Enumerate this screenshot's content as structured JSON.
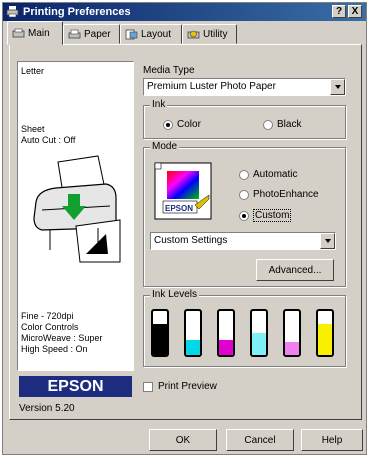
{
  "window": {
    "title": "Printing Preferences",
    "help_btn": "?",
    "close_btn": "X"
  },
  "tabs": [
    {
      "label": "Main",
      "active": true
    },
    {
      "label": "Paper",
      "active": false
    },
    {
      "label": "Layout",
      "active": false
    },
    {
      "label": "Utility",
      "active": false
    }
  ],
  "preview": {
    "paper_size": "Letter",
    "source": "Sheet",
    "auto_cut": "Auto Cut : Off",
    "resolution": "Fine - 720dpi",
    "color_controls": "Color Controls",
    "microweave": "MicroWeave : Super",
    "high_speed": "High Speed : On"
  },
  "brand": {
    "logo": "EPSON",
    "version": "Version 5.20"
  },
  "media_type": {
    "label": "Media Type",
    "value": "Premium Luster Photo Paper"
  },
  "ink": {
    "label": "Ink",
    "options": [
      "Color",
      "Black"
    ],
    "selected": "Color"
  },
  "mode": {
    "label": "Mode",
    "options": [
      "Automatic",
      "PhotoEnhance",
      "Custom"
    ],
    "selected": "Custom",
    "icon_label": "EPSON",
    "custom_settings": "Custom Settings",
    "advanced_label": "Advanced..."
  },
  "ink_levels": {
    "label": "Ink Levels",
    "cartridges": [
      {
        "name": "Black",
        "color": "#000000",
        "level": 0.7
      },
      {
        "name": "Cyan",
        "color": "#00d8e8",
        "level": 0.35
      },
      {
        "name": "Magenta",
        "color": "#e000d0",
        "level": 0.35
      },
      {
        "name": "Light Cyan",
        "color": "#80f0f8",
        "level": 0.5
      },
      {
        "name": "Light Magenta",
        "color": "#f080f0",
        "level": 0.3
      },
      {
        "name": "Yellow",
        "color": "#f8f000",
        "level": 0.7
      }
    ]
  },
  "print_preview": {
    "label": "Print Preview",
    "checked": false
  },
  "footer": {
    "ok": "OK",
    "cancel": "Cancel",
    "help": "Help"
  }
}
